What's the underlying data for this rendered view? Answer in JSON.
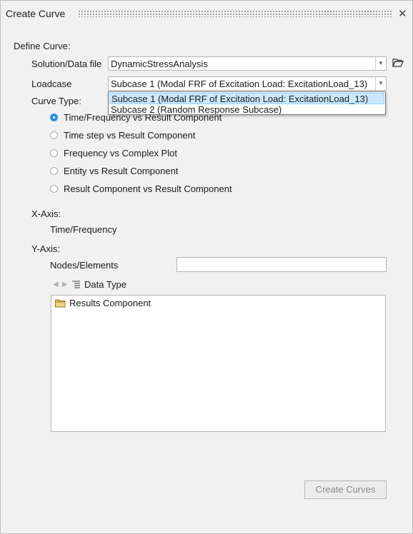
{
  "window": {
    "title": "Create Curve"
  },
  "define_curve": {
    "label": "Define Curve:"
  },
  "solution": {
    "label": "Solution/Data file",
    "value": "DynamicStressAnalysis"
  },
  "loadcase": {
    "label": "Loadcase",
    "value": "Subcase 1 (Modal FRF of Excitation Load: ExcitationLoad_13)",
    "options": [
      "Subcase 1 (Modal FRF of Excitation Load: ExcitationLoad_13)",
      "Subcase 2 (Random Response Subcase)"
    ]
  },
  "curve_type": {
    "label": "Curve Type:",
    "options": [
      "Time/Frequency vs Result Component",
      "Time step vs Result Component",
      "Frequency vs Complex Plot",
      "Entity vs Result Component",
      "Result Component vs Result Component"
    ],
    "selected_index": 0
  },
  "x_axis": {
    "label": "X-Axis:",
    "value": "Time/Frequency"
  },
  "y_axis": {
    "label": "Y-Axis:",
    "nodes_label": "Nodes/Elements",
    "nodes_value": "",
    "data_type_label": "Data Type",
    "tree_items": [
      "Results Component"
    ]
  },
  "buttons": {
    "create_curves": "Create Curves"
  },
  "colors": {
    "accent": "#2a8ee8",
    "selection": "#cce8ff"
  }
}
